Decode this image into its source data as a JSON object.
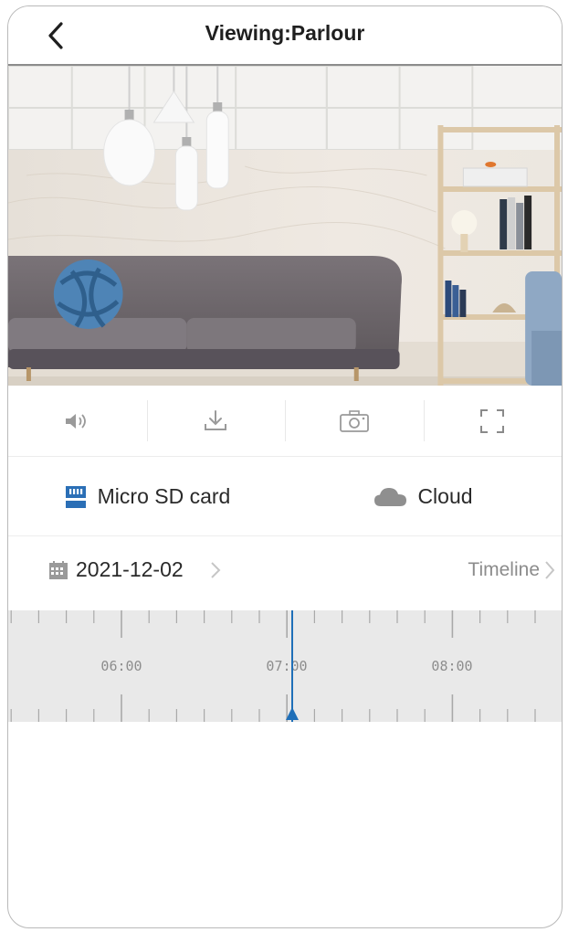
{
  "header": {
    "title": "Viewing:Parlour",
    "back_icon": "chevron-left-icon"
  },
  "video": {
    "description": "live-camera-feed"
  },
  "controls": [
    {
      "name": "volume",
      "icon": "speaker-icon"
    },
    {
      "name": "download",
      "icon": "download-icon"
    },
    {
      "name": "snapshot",
      "icon": "camera-icon"
    },
    {
      "name": "fullscreen",
      "icon": "fullscreen-icon"
    }
  ],
  "storage": {
    "sd_label": "Micro SD card",
    "sd_icon": "sd-card-icon",
    "cloud_label": "Cloud",
    "cloud_icon": "cloud-icon"
  },
  "date": {
    "value": "2021-12-02",
    "icon": "calendar-icon"
  },
  "timeline": {
    "link_label": "Timeline",
    "hours": [
      "06:00",
      "07:00",
      "08:00"
    ],
    "current_time_marker": "07:00"
  },
  "colors": {
    "accent": "#1f6fb8",
    "sd_icon": "#2b6fb6",
    "cloud_icon": "#8f8f8f",
    "timeline_bg": "#e9e9e9"
  }
}
